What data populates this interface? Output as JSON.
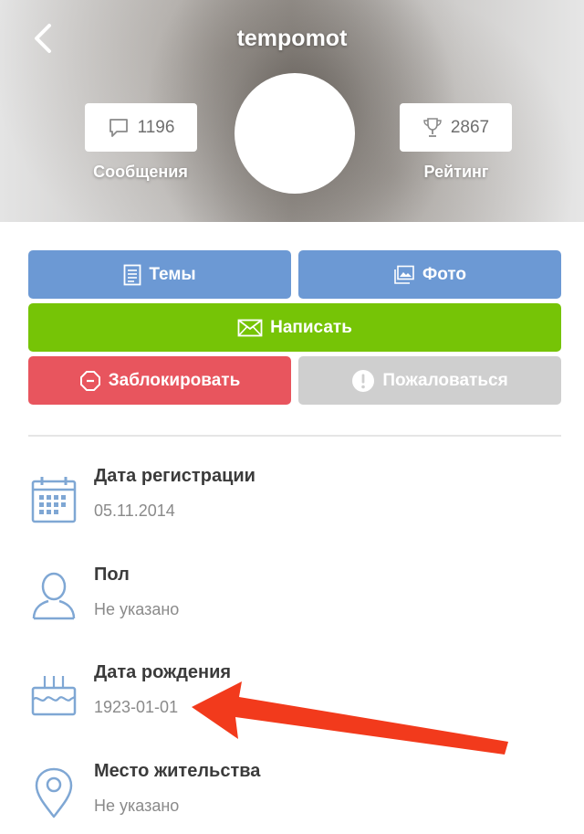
{
  "header": {
    "username": "tempomot",
    "messages": {
      "count": "1196",
      "label": "Сообщения"
    },
    "rating": {
      "count": "2867",
      "label": "Рейтинг"
    }
  },
  "buttons": {
    "topics": "Темы",
    "photo": "Фото",
    "write": "Написать",
    "block": "Заблокировать",
    "report": "Пожаловаться"
  },
  "info": [
    {
      "label": "Дата регистрации",
      "value": "05.11.2014",
      "icon": "calendar-icon"
    },
    {
      "label": "Пол",
      "value": "Не указано",
      "icon": "user-icon"
    },
    {
      "label": "Дата рождения",
      "value": "1923-01-01",
      "icon": "birthday-cake-icon"
    },
    {
      "label": "Место жительства",
      "value": "Не указано",
      "icon": "location-pin-icon"
    }
  ],
  "colors": {
    "primary_blue": "#6c99d4",
    "write_green": "#76c406",
    "block_red": "#e8555e",
    "report_gray": "#cfcfcf",
    "icon_blue": "#7fa7d4",
    "annotation_arrow": "#f23a1c"
  }
}
